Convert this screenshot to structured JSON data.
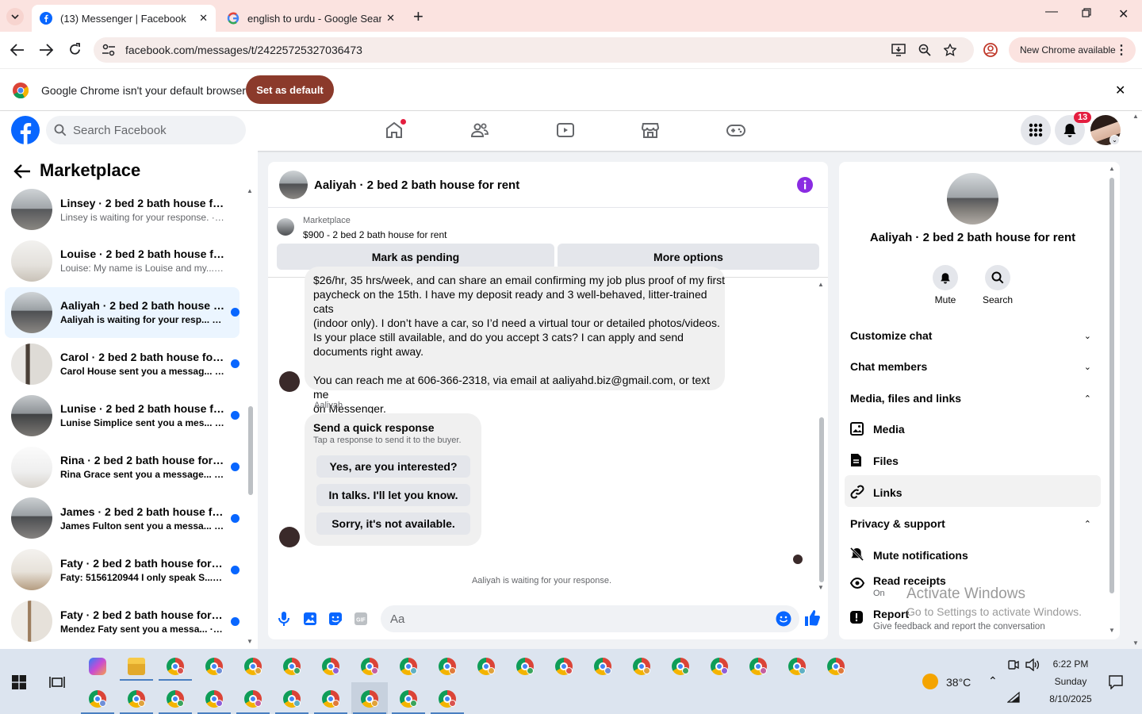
{
  "browser": {
    "tabs": [
      {
        "title": "(13) Messenger | Facebook",
        "active": true
      },
      {
        "title": "english to urdu - Google Search",
        "active": false
      }
    ],
    "url": "facebook.com/messages/t/24225725327036473",
    "new_chrome": "New Chrome available",
    "infobar_message": "Google Chrome isn't your default browser",
    "set_default": "Set as default"
  },
  "fb": {
    "search_placeholder": "Search Facebook",
    "notif_count": "13"
  },
  "sidebar": {
    "title": "Marketplace",
    "conversations": [
      {
        "title": "Linsey · 2 bed 2 bath house for r...",
        "sub": "Linsey is waiting for your response. · 1m",
        "unread": false,
        "selected": false
      },
      {
        "title": "Louise · 2 bed 2 bath house for ...",
        "sub": "Louise: My name is Louise and my... · 1m",
        "unread": false,
        "selected": false
      },
      {
        "title": "Aaliyah · 2 bed 2 bath house f...",
        "sub": "Aaliyah is waiting for your resp... · 1m",
        "unread": true,
        "selected": true
      },
      {
        "title": "Carol · 2 bed 2 bath house for ...",
        "sub": "Carol House sent you a messag... · 1m",
        "unread": true,
        "selected": false
      },
      {
        "title": "Lunise · 2 bed 2 bath house fo...",
        "sub": "Lunise Simplice sent you a mes... · 1m",
        "unread": true,
        "selected": false
      },
      {
        "title": "Rina · 2 bed 2 bath house for r...",
        "sub": "Rina Grace sent you a message... · 1m",
        "unread": true,
        "selected": false
      },
      {
        "title": "James · 2 bed 2 bath house fo...",
        "sub": "James Fulton sent you a messa... · 1m",
        "unread": true,
        "selected": false
      },
      {
        "title": "Faty · 2 bed 2 bath house for r...",
        "sub": "Faty: 5156120944 I only speak S... · 1m",
        "unread": true,
        "selected": false
      },
      {
        "title": "Faty · 2 bed 2 bath house for r...",
        "sub": "Mendez Faty sent you a messa... · 1m",
        "unread": true,
        "selected": false
      }
    ]
  },
  "chat": {
    "title": "Aaliyah · 2 bed 2 bath house for rent",
    "marketplace_label": "Marketplace",
    "listing": "$900 - 2 bed 2 bath house for rent",
    "mark_pending": "Mark as pending",
    "more_options": "More options",
    "message_lines": [
      "$26/hr, 35 hrs/week, and can share an email confirming my job plus proof of my first",
      "paycheck on the 15th. I have my deposit ready and 3 well-behaved, litter-trained cats",
      "(indoor only). I don’t have a car, so I’d need a virtual tour or detailed photos/videos.",
      "Is your place still available, and do you accept 3 cats? I can apply and send",
      "documents right away."
    ],
    "contact_lines": [
      "You can reach me at 606-366-2318, via email at aaliyahd.biz@gmail.com, or text me",
      "on Messenger."
    ],
    "sender": "Aaliyah",
    "quick_title": "Send a quick response",
    "quick_sub": "Tap a response to send it to the buyer.",
    "quick_replies": [
      "Yes, are you interested?",
      "In talks. I'll let you know.",
      "Sorry, it's not available."
    ],
    "waiting": "Aaliyah is waiting for your response.",
    "input_placeholder": "Aa"
  },
  "info": {
    "name": "Aaliyah · 2 bed 2 bath house for rent",
    "mute": "Mute",
    "search": "Search",
    "customize": "Customize chat",
    "members": "Chat members",
    "media_section": "Media, files and links",
    "media": "Media",
    "files": "Files",
    "links": "Links",
    "privacy": "Privacy & support",
    "mute_notifications": "Mute notifications",
    "read_receipts": "Read receipts",
    "read_receipts_state": "On",
    "report": "Report",
    "report_sub": "Give feedback and report the conversation"
  },
  "watermark": {
    "title": "Activate Windows",
    "sub": "Go to Settings to activate Windows."
  },
  "taskbar": {
    "temperature": "38°C",
    "time": "6:22 PM",
    "day": "Sunday",
    "date": "8/10/2025"
  }
}
